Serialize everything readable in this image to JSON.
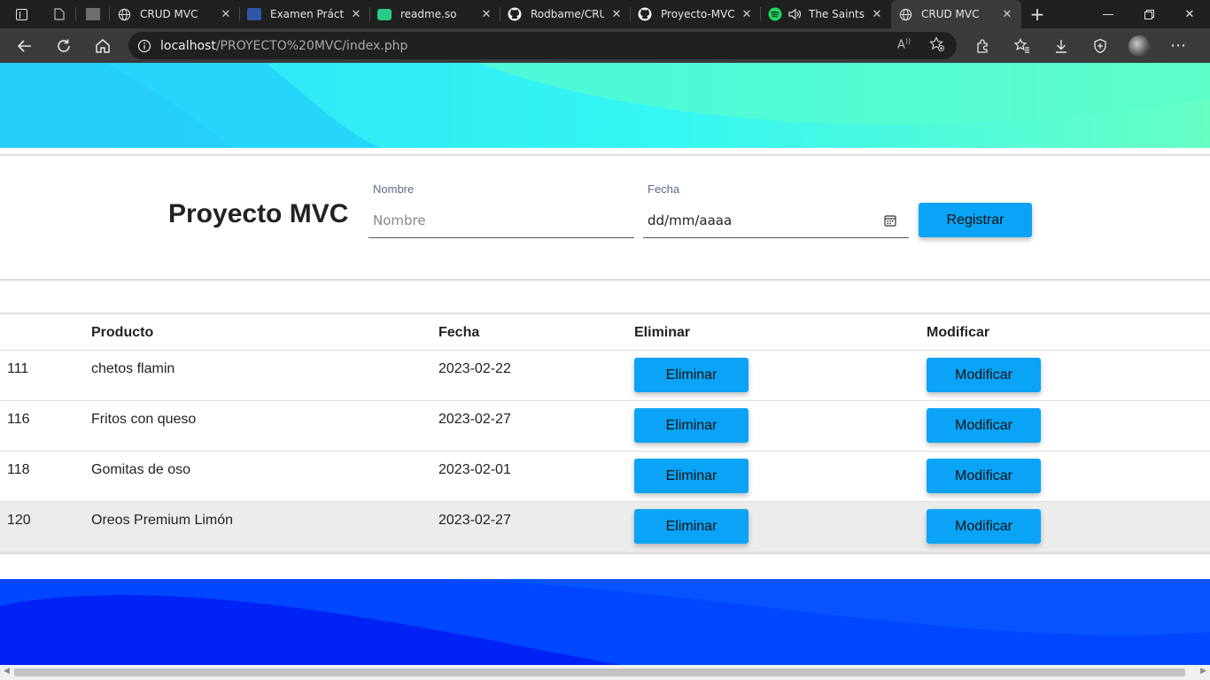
{
  "browser": {
    "tabs": [
      {
        "title": "",
        "icon": "page-icon",
        "small": true
      },
      {
        "title": "",
        "icon": "image-icon",
        "small": true
      },
      {
        "title": "CRUD MVC",
        "icon": "globe-icon"
      },
      {
        "title": "Examen Práctic",
        "icon": "classroom-icon"
      },
      {
        "title": "readme.so",
        "icon": "readme-icon"
      },
      {
        "title": "Rodbame/CRU",
        "icon": "github-icon"
      },
      {
        "title": "Proyecto-MVC/",
        "icon": "github-icon"
      },
      {
        "title": "The Saints",
        "icon": "spotify-icon"
      },
      {
        "title": "CRUD MVC",
        "icon": "globe-icon",
        "active": true
      }
    ],
    "address": {
      "host": "localhost",
      "path": "/PROYECTO%20MVC/index.php"
    }
  },
  "form": {
    "title": "Proyecto MVC",
    "nombre_label": "Nombre",
    "nombre_placeholder": "Nombre",
    "nombre_value": "",
    "fecha_label": "Fecha",
    "fecha_value": "dd/mm/aaaa",
    "register_label": "Registrar"
  },
  "table": {
    "headers": {
      "id": "",
      "producto": "Producto",
      "fecha": "Fecha",
      "eliminar": "Eliminar",
      "modificar": "Modificar"
    },
    "rows": [
      {
        "id": "111",
        "producto": "chetos flamin",
        "fecha": "2023-02-22",
        "eliminar": "Eliminar",
        "modificar": "Modificar"
      },
      {
        "id": "116",
        "producto": "Fritos con queso",
        "fecha": "2023-02-27",
        "eliminar": "Eliminar",
        "modificar": "Modificar"
      },
      {
        "id": "118",
        "producto": "Gomitas de oso",
        "fecha": "2023-02-01",
        "eliminar": "Eliminar",
        "modificar": "Modificar"
      },
      {
        "id": "120",
        "producto": "Oreos Premium Limón",
        "fecha": "2023-02-27",
        "eliminar": "Eliminar",
        "modificar": "Modificar"
      }
    ]
  },
  "colors": {
    "button": "#0aa3f5",
    "wave_top_start": "#2de6fb",
    "wave_top_end": "#60fdc7",
    "wave_bottom": "#0046ff"
  }
}
